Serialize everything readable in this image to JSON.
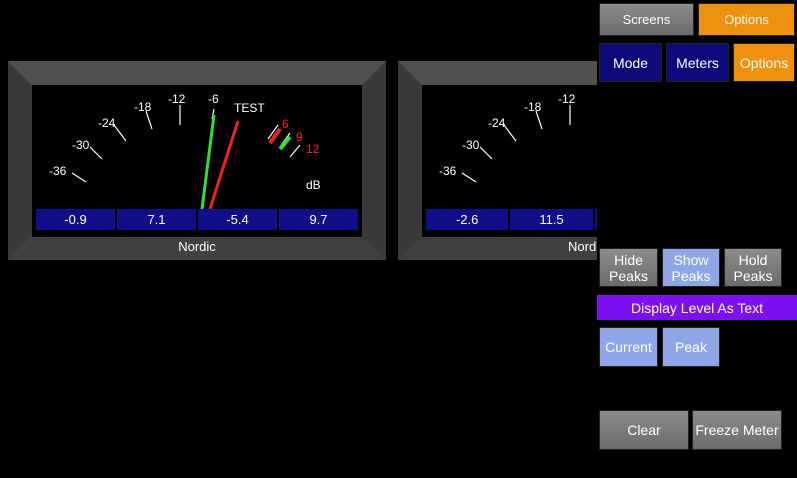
{
  "meters": [
    {
      "name": "Nordic",
      "scale": [
        "-36",
        "-30",
        "-24",
        "-18",
        "-12",
        "-6",
        "TEST",
        "6",
        "9",
        "12"
      ],
      "unit": "dB",
      "readouts": [
        "-0.9",
        "7.1",
        "-5.4",
        "9.7"
      ]
    },
    {
      "name": "Nord",
      "scale": [
        "-36",
        "-30",
        "-24",
        "-18",
        "-12"
      ],
      "readouts": [
        "-2.6",
        "11.5"
      ]
    }
  ],
  "top_tabs": {
    "screens": "Screens",
    "options": "Options"
  },
  "sub_tabs": {
    "mode": "Mode",
    "meters": "Meters",
    "options": "Options"
  },
  "peaks": {
    "hide": "Hide Peaks",
    "show": "Show Peaks",
    "hold": "Hold Peaks"
  },
  "display_level_banner": "Display Level As Text",
  "level_text": {
    "current": "Current",
    "peak": "Peak"
  },
  "actions": {
    "clear": "Clear",
    "freeze": "Freeze Meter"
  },
  "colors": {
    "bezel": "#454545",
    "readout_bg": "#0f0f8a",
    "needle_green": "#33dd33",
    "needle_red": "#ee2222",
    "scale_red": "#ff2020",
    "accent_orange": "#f0900f",
    "accent_purple": "#7c10f0"
  }
}
